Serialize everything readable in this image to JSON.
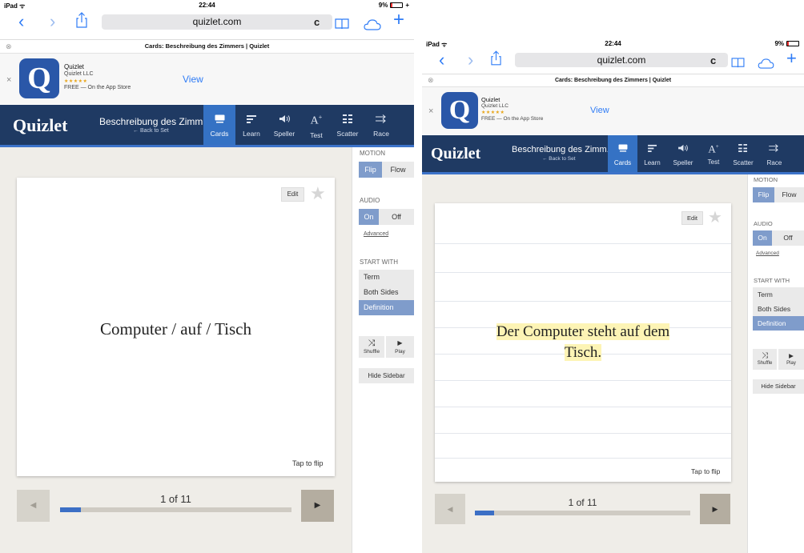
{
  "device": "iPad",
  "time": "22:44",
  "battery": "9%",
  "browser": {
    "url": "quizlet.com",
    "tab_title": "Cards: Beschreibung des Zimmers | Quizlet"
  },
  "app_banner": {
    "name": "Quizlet",
    "developer": "Quizlet LLC",
    "stars": "★★★★★",
    "price": "FREE — On the App Store",
    "view_label": "View",
    "icon_letter": "Q"
  },
  "header": {
    "logo": "Quizlet",
    "set_title": "Beschreibung des Zimm..",
    "back_link": "← Back to Set",
    "tabs": [
      {
        "label": "Cards",
        "icon": "cards-icon",
        "active": true
      },
      {
        "label": "Learn",
        "icon": "learn-icon",
        "active": false
      },
      {
        "label": "Speller",
        "icon": "speaker-icon",
        "active": false
      },
      {
        "label": "Test",
        "icon": "test-icon",
        "active": false
      },
      {
        "label": "Scatter",
        "icon": "scatter-icon",
        "active": false
      },
      {
        "label": "Race",
        "icon": "race-icon",
        "active": false
      }
    ]
  },
  "card": {
    "edit_label": "Edit",
    "tap_hint": "Tap to flip",
    "left_text": "Computer / auf / Tisch",
    "right_line1": "Der Computer steht auf dem",
    "right_line2": "Tisch."
  },
  "navigation": {
    "progress_label": "1 of 11",
    "progress_fraction": 0.09
  },
  "sidebar": {
    "motion": {
      "heading": "MOTION",
      "options": [
        "Flip",
        "Flow"
      ],
      "selected": "Flip"
    },
    "audio": {
      "heading": "AUDIO",
      "options": [
        "On",
        "Off"
      ],
      "selected": "On",
      "advanced": "Advanced"
    },
    "start_with": {
      "heading": "START WITH",
      "options": [
        "Term",
        "Both Sides",
        "Definition"
      ],
      "selected": "Definition"
    },
    "shuffle_label": "Shuffle",
    "play_label": "Play",
    "hide_label": "Hide Sidebar"
  },
  "colors": {
    "header": "#1f3a63",
    "active_tab": "#3572c4",
    "selected_option": "#7f9ccb",
    "study_bg": "#efede8",
    "highlight": "#fdf4b5",
    "progress": "#3c6fc5",
    "ios_blue": "#2f7cf6"
  }
}
